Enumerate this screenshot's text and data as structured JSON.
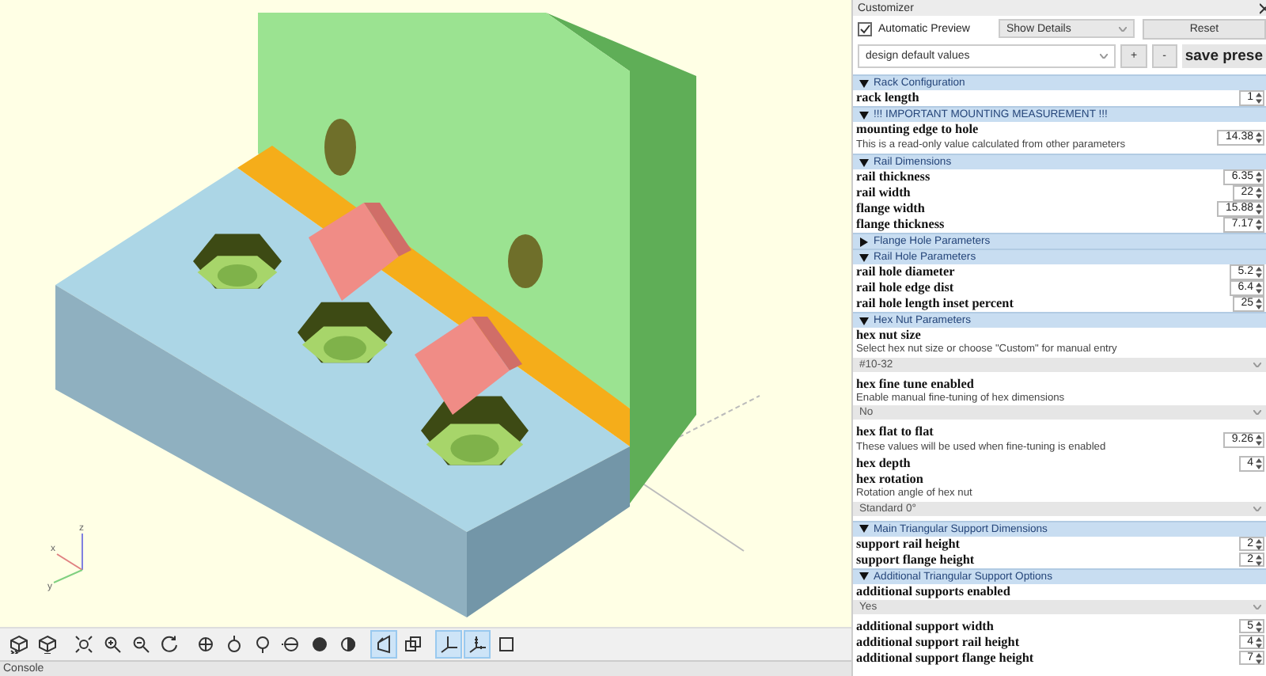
{
  "viewport": {
    "axis_labels": [
      "z",
      "x",
      "y"
    ]
  },
  "toolbar": {
    "groups": [
      [
        {
          "kind": "preview",
          "selected": false
        },
        {
          "kind": "render",
          "selected": false
        }
      ],
      [
        {
          "kind": "zoom-all",
          "selected": false
        },
        {
          "kind": "zoom-in",
          "selected": false
        },
        {
          "kind": "zoom-out",
          "selected": false
        },
        {
          "kind": "reset-view",
          "selected": false
        }
      ],
      [
        {
          "kind": "view-right",
          "selected": false
        },
        {
          "kind": "view-top",
          "selected": false
        },
        {
          "kind": "view-bottom",
          "selected": false
        },
        {
          "kind": "view-left",
          "selected": false
        },
        {
          "kind": "view-front",
          "selected": false
        },
        {
          "kind": "view-back",
          "selected": false
        }
      ],
      [
        {
          "kind": "perspective",
          "selected": true
        },
        {
          "kind": "orthogonal",
          "selected": false
        }
      ],
      [
        {
          "kind": "axes",
          "selected": true
        },
        {
          "kind": "scale-markers",
          "selected": true
        },
        {
          "kind": "edges",
          "selected": false
        }
      ]
    ]
  },
  "console": {
    "title": "Console"
  },
  "customizer": {
    "title": "Customizer",
    "automatic_preview": {
      "label": "Automatic Preview",
      "checked": true
    },
    "details": {
      "value": "Show Details"
    },
    "reset": {
      "label": "Reset"
    },
    "preset": {
      "value": "design default values"
    },
    "preset_buttons": [
      "+",
      "-"
    ],
    "save_preset": {
      "label": "save prese"
    },
    "sections": [
      {
        "title": "Rack Configuration",
        "expanded": true,
        "params": [
          {
            "kind": "number",
            "label": "rack length",
            "value": "1"
          }
        ]
      },
      {
        "title": "!!! IMPORTANT MOUNTING MEASUREMENT !!!",
        "expanded": true,
        "params": [
          {
            "kind": "number",
            "label": "mounting edge to hole",
            "description": "This is a read-only value calculated from other parameters",
            "value": "14.38"
          }
        ]
      },
      {
        "title": "Rail Dimensions",
        "expanded": true,
        "params": [
          {
            "kind": "number",
            "label": "rail thickness",
            "value": "6.35"
          },
          {
            "kind": "number",
            "label": "rail width",
            "value": "22"
          },
          {
            "kind": "number",
            "label": "flange width",
            "value": "15.88"
          },
          {
            "kind": "number",
            "label": "flange thickness",
            "value": "7.17"
          }
        ]
      },
      {
        "title": "Flange Hole Parameters",
        "expanded": false
      },
      {
        "title": "Rail Hole Parameters",
        "expanded": true,
        "params": [
          {
            "kind": "number",
            "label": "rail hole diameter",
            "value": "5.2"
          },
          {
            "kind": "number",
            "label": "rail hole edge dist",
            "value": "6.4"
          },
          {
            "kind": "number",
            "label": "rail hole length inset percent",
            "value": "25"
          }
        ]
      },
      {
        "title": "Hex Nut Parameters",
        "expanded": true,
        "params": [
          {
            "kind": "select",
            "label": "hex nut size",
            "description": "Select hex nut size or choose \"Custom\" for manual entry",
            "value": "#10-32"
          },
          {
            "kind": "select",
            "label": "hex fine tune enabled",
            "description": "Enable manual fine-tuning of hex dimensions",
            "value": "No"
          },
          {
            "kind": "number",
            "label": "hex flat to flat",
            "description": "These values will be used when fine-tuning is enabled",
            "value": "9.26"
          },
          {
            "kind": "number",
            "label": "hex depth",
            "value": "4"
          },
          {
            "kind": "select",
            "label": "hex rotation",
            "description": "Rotation angle of hex nut",
            "value": "Standard 0°"
          }
        ]
      },
      {
        "title": "Main Triangular Support Dimensions",
        "expanded": true,
        "params": [
          {
            "kind": "number",
            "label": "support rail height",
            "value": "2"
          },
          {
            "kind": "number",
            "label": "support flange height",
            "value": "2"
          }
        ]
      },
      {
        "title": "Additional Triangular Support Options",
        "expanded": true,
        "params": [
          {
            "kind": "select",
            "label": "additional supports enabled",
            "value": "Yes"
          },
          {
            "kind": "number",
            "label": "additional support width",
            "value": "5"
          },
          {
            "kind": "number",
            "label": "additional support rail height",
            "value": "4"
          },
          {
            "kind": "number",
            "label": "additional support flange height",
            "value": "7"
          }
        ]
      }
    ]
  }
}
